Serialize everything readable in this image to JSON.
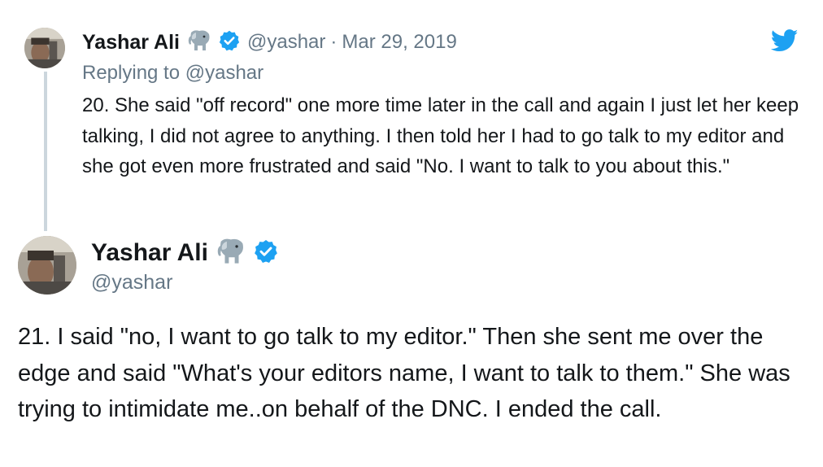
{
  "tweet1": {
    "display_name": "Yashar Ali",
    "handle": "@yashar",
    "separator": "·",
    "date": "Mar 29, 2019",
    "replying_prefix": "Replying to",
    "replying_to": "@yashar",
    "text": "20. She said \"off record\" one more time later in the call and again I just let her keep talking, I did not agree to anything. I then told her I had to go talk to my editor and she got even more frustrated and said \"No. I want to talk to you about this.\""
  },
  "tweet2": {
    "display_name": "Yashar Ali",
    "handle": "@yashar",
    "text": "21. I said \"no, I want to go talk to my editor.\" Then she sent me over the edge and said \"What's your editors name, I want to talk to them.\" She was trying to intimidate me..on behalf of the DNC. I ended the call."
  },
  "icons": {
    "name_emoji": "elephant-emoji",
    "verified": "verified-badge-icon",
    "brand": "twitter-bird-icon"
  },
  "colors": {
    "text": "#14171a",
    "secondary": "#657786",
    "verified_blue": "#1da1f2",
    "twitter_blue": "#1da1f2",
    "thread_line": "#ccd6dd"
  }
}
